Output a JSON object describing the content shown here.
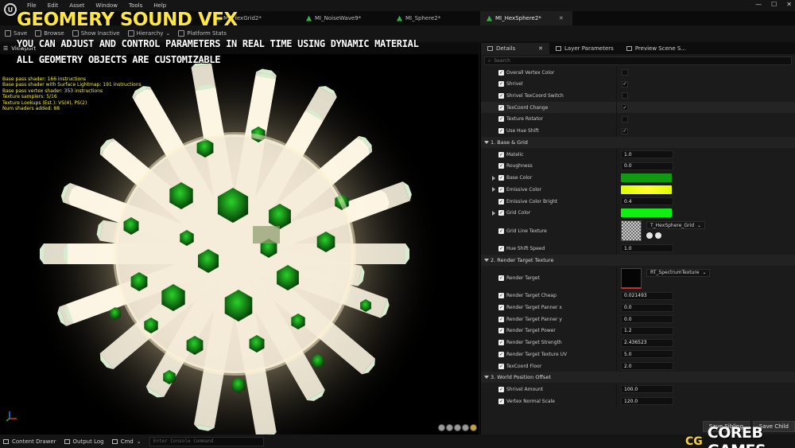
{
  "app": {
    "logo_icon": "unreal-engine-logo",
    "menu": [
      "File",
      "Edit",
      "Asset",
      "Window",
      "Tools",
      "Help"
    ],
    "window_controls": [
      "—",
      "☐",
      "✕"
    ]
  },
  "document_tabs": [
    {
      "label": "MI_HexGrid2*",
      "icon": "material-instance-icon"
    },
    {
      "label": "MI_NoiseWave9*",
      "icon": "material-instance-icon"
    },
    {
      "label": "MI_Sphere2*",
      "icon": "material-instance-icon"
    },
    {
      "label": "MI_HexSphere2*",
      "icon": "material-instance-icon",
      "active": true
    }
  ],
  "toolbar": {
    "save": "Save",
    "browse": "Browse",
    "show_inactive": "Show Inactive",
    "hierarchy": "Hierarchy",
    "platform_stats": "Platform Stats"
  },
  "viewport": {
    "label": "Viewport",
    "stats": [
      "Base pass shader: 166 instructions",
      "Base pass shader with Surface Lightmap: 191 instructions",
      "Base pass vertex shader: 353 instructions",
      "Texture samplers: 5/16",
      "Texture Lookups (Est.): VS(4), PS(2)",
      "Num shaders added: 88"
    ]
  },
  "overlay": {
    "title": "GEOMERY SOUND VFX",
    "line1": "YOU CAN ADJUST AND CONTROL PARAMETERS IN REAL TIME USING DYNAMIC MATERIAL",
    "line2": "ALL GEOMETRY OBJECTS ARE CUSTOMIZABLE"
  },
  "details_panel": {
    "tabs": [
      "Details",
      "Layer Parameters",
      "Preview Scene S..."
    ],
    "search_placeholder": "Search",
    "top_rows": [
      {
        "label": "Overall Vertex Color",
        "checked": false
      },
      {
        "label": "Shrivel",
        "checked": true
      },
      {
        "label": "Shrivel TexCoord Switch",
        "checked": false
      },
      {
        "label": "TexCoord Change",
        "checked": true,
        "highlight": true
      },
      {
        "label": "Texture Rotator",
        "checked": false
      },
      {
        "label": "Use Hue Shift",
        "checked": true
      }
    ],
    "sections": [
      {
        "title": "1. Base & Grid",
        "rows": [
          {
            "label": "Matelic",
            "type": "number",
            "value": "1.0"
          },
          {
            "label": "Roughness",
            "type": "number",
            "value": "0.0"
          },
          {
            "label": "Base Color",
            "type": "color",
            "color": "#119a11",
            "expander": true
          },
          {
            "label": "Emissive Color",
            "type": "gradient",
            "expander": true
          },
          {
            "label": "Emissive Color Bright",
            "type": "number",
            "value": "0.4"
          },
          {
            "label": "Grid Color",
            "type": "color",
            "color": "#12ee12",
            "expander": true
          },
          {
            "label": "Grid Line Texture",
            "type": "texture",
            "asset": "T_HexSphere_Grid",
            "thumb": "checker"
          },
          {
            "label": "Hue Shift Speed",
            "type": "number",
            "value": "1.0"
          }
        ]
      },
      {
        "title": "2. Render Target Texture",
        "rows": [
          {
            "label": "Render Target",
            "type": "texture",
            "asset": "RT_SpectrumTexture",
            "thumb": "black"
          },
          {
            "label": "Render Target Cheap",
            "type": "number",
            "value": "0.021493"
          },
          {
            "label": "Render Target Panner x",
            "type": "number",
            "value": "0.0"
          },
          {
            "label": "Render Target Panner y",
            "type": "number",
            "value": "0.0"
          },
          {
            "label": "Render Target Power",
            "type": "number",
            "value": "1.2"
          },
          {
            "label": "Render Target Strength",
            "type": "number",
            "value": "2.436523"
          },
          {
            "label": "Render Target Texture UV",
            "type": "number",
            "value": "5.0"
          },
          {
            "label": "TexCoord Floor",
            "type": "number",
            "value": "2.0"
          }
        ]
      },
      {
        "title": "3. World Position Offset",
        "rows": [
          {
            "label": "Shrivel Amount",
            "type": "number",
            "value": "100.0"
          },
          {
            "label": "Vertex Normal Scale",
            "type": "number",
            "value": "120.0"
          }
        ]
      }
    ],
    "buttons": {
      "save_sibling": "Save Sibling",
      "save_child": "Save Child"
    }
  },
  "statusbar": {
    "content_drawer": "Content Drawer",
    "output_log": "Output Log",
    "cmd": "Cmd",
    "console_placeholder": "Enter Console Command"
  },
  "watermark": {
    "badge": "CG",
    "text": "COREB GAMES"
  }
}
